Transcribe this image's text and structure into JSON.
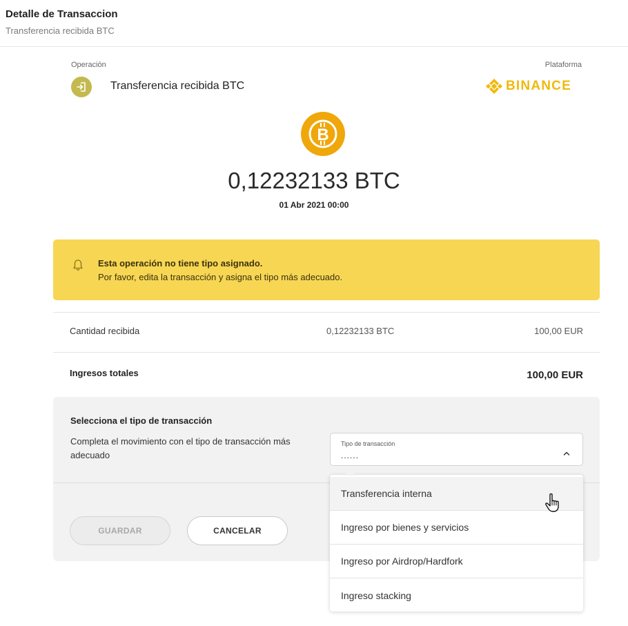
{
  "header": {
    "title": "Detalle de Transaccion",
    "subtitle": "Transferencia recibida BTC"
  },
  "operation": {
    "label": "Operación",
    "type": "Transferencia recibida BTC",
    "icon": "login-arrow-icon"
  },
  "platform": {
    "label": "Plataforma",
    "name": "BINANCE",
    "brand_color": "#f0b90b"
  },
  "asset": {
    "icon": "bitcoin-icon",
    "color": "#f0a70a",
    "amount": "0,12232133 BTC",
    "date": "01 Abr 2021 00:00"
  },
  "alert": {
    "icon": "bell-icon",
    "color": "#f7d653",
    "title": "Esta operación no tiene tipo asignado.",
    "message": "Por favor, edita la transacción y asigna el tipo más adecuado."
  },
  "rows": [
    {
      "label": "Cantidad recibida",
      "crypto": "0,12232133 BTC",
      "fiat": "100,00 EUR"
    }
  ],
  "total": {
    "label": "Ingresos totales",
    "value": "100,00 EUR"
  },
  "type_panel": {
    "title": "Selecciona el tipo de transacción",
    "description": "Completa el movimiento con el tipo de transacción más adecuado",
    "select": {
      "label": "Tipo de transacción",
      "value": "......",
      "options": [
        "Transferencia interna",
        "Ingreso por bienes y servicios",
        "Ingreso por Airdrop/Hardfork",
        "Ingreso stacking"
      ]
    },
    "save_label": "GUARDAR",
    "cancel_label": "CANCELAR"
  }
}
